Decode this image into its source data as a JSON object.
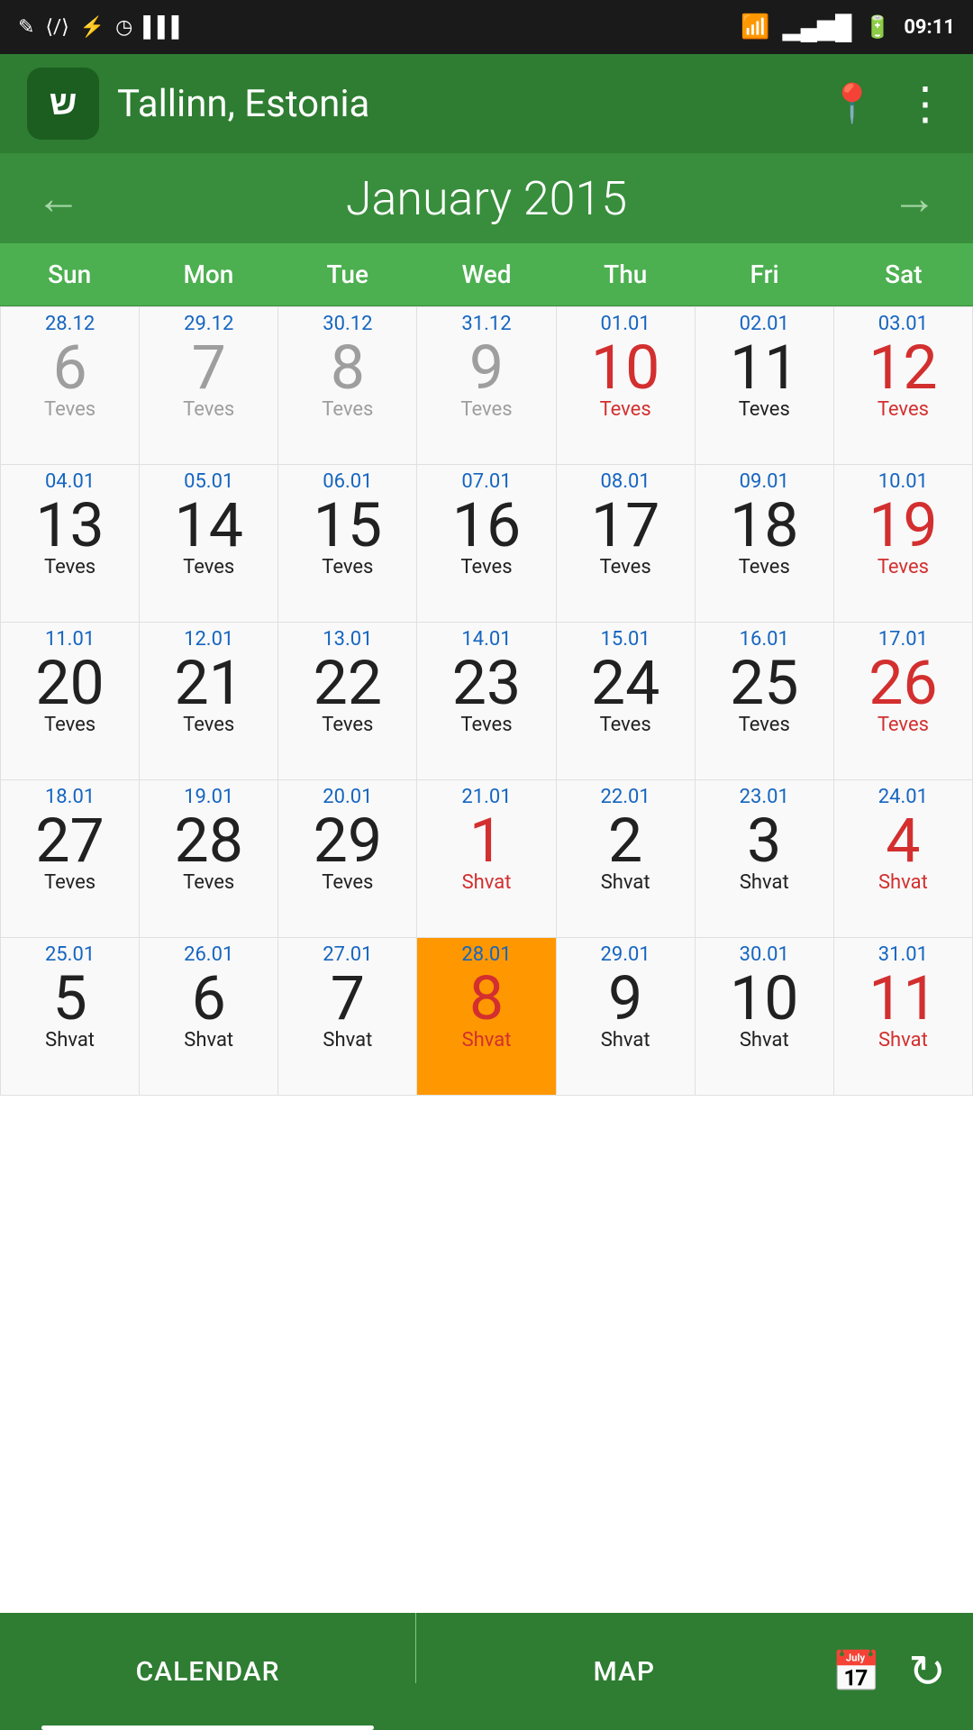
{
  "statusBar": {
    "time": "09:11",
    "leftIcons": [
      "✎",
      "⟨/⟩",
      "⚡",
      "◷",
      "▐▌▌"
    ],
    "rightIcons": [
      "wifi",
      "signal",
      "battery"
    ]
  },
  "header": {
    "logoText": "ש",
    "title": "Tallinn, Estonia",
    "locationIcon": "📍",
    "moreIcon": "⋮"
  },
  "monthNav": {
    "prevArrow": "←",
    "nextArrow": "→",
    "monthTitle": "January 2015"
  },
  "dayHeaders": [
    "Sun",
    "Mon",
    "Tue",
    "Wed",
    "Thu",
    "Fri",
    "Sat"
  ],
  "calendarCells": [
    {
      "greg": "28.12",
      "day": "6",
      "heb": "Teves",
      "dayColor": "gray",
      "hebColor": "gray",
      "gregColor": "normal"
    },
    {
      "greg": "29.12",
      "day": "7",
      "heb": "Teves",
      "dayColor": "gray",
      "hebColor": "gray",
      "gregColor": "normal"
    },
    {
      "greg": "30.12",
      "day": "8",
      "heb": "Teves",
      "dayColor": "gray",
      "hebColor": "gray",
      "gregColor": "normal"
    },
    {
      "greg": "31.12",
      "day": "9",
      "heb": "Teves",
      "dayColor": "gray",
      "hebColor": "gray",
      "gregColor": "normal"
    },
    {
      "greg": "01.01",
      "day": "10",
      "heb": "Teves",
      "dayColor": "red",
      "hebColor": "red",
      "gregColor": "normal"
    },
    {
      "greg": "02.01",
      "day": "11",
      "heb": "Teves",
      "dayColor": "black",
      "hebColor": "black",
      "gregColor": "normal"
    },
    {
      "greg": "03.01",
      "day": "12",
      "heb": "Teves",
      "dayColor": "red",
      "hebColor": "red",
      "gregColor": "normal"
    },
    {
      "greg": "04.01",
      "day": "13",
      "heb": "Teves",
      "dayColor": "black",
      "hebColor": "black",
      "gregColor": "normal"
    },
    {
      "greg": "05.01",
      "day": "14",
      "heb": "Teves",
      "dayColor": "black",
      "hebColor": "black",
      "gregColor": "normal"
    },
    {
      "greg": "06.01",
      "day": "15",
      "heb": "Teves",
      "dayColor": "black",
      "hebColor": "black",
      "gregColor": "normal"
    },
    {
      "greg": "07.01",
      "day": "16",
      "heb": "Teves",
      "dayColor": "black",
      "hebColor": "black",
      "gregColor": "normal"
    },
    {
      "greg": "08.01",
      "day": "17",
      "heb": "Teves",
      "dayColor": "black",
      "hebColor": "black",
      "gregColor": "normal"
    },
    {
      "greg": "09.01",
      "day": "18",
      "heb": "Teves",
      "dayColor": "black",
      "hebColor": "black",
      "gregColor": "normal"
    },
    {
      "greg": "10.01",
      "day": "19",
      "heb": "Teves",
      "dayColor": "red",
      "hebColor": "red",
      "gregColor": "normal"
    },
    {
      "greg": "11.01",
      "day": "20",
      "heb": "Teves",
      "dayColor": "black",
      "hebColor": "black",
      "gregColor": "normal"
    },
    {
      "greg": "12.01",
      "day": "21",
      "heb": "Teves",
      "dayColor": "black",
      "hebColor": "black",
      "gregColor": "normal"
    },
    {
      "greg": "13.01",
      "day": "22",
      "heb": "Teves",
      "dayColor": "black",
      "hebColor": "black",
      "gregColor": "normal"
    },
    {
      "greg": "14.01",
      "day": "23",
      "heb": "Teves",
      "dayColor": "black",
      "hebColor": "black",
      "gregColor": "normal"
    },
    {
      "greg": "15.01",
      "day": "24",
      "heb": "Teves",
      "dayColor": "black",
      "hebColor": "black",
      "gregColor": "normal"
    },
    {
      "greg": "16.01",
      "day": "25",
      "heb": "Teves",
      "dayColor": "black",
      "hebColor": "black",
      "gregColor": "normal"
    },
    {
      "greg": "17.01",
      "day": "26",
      "heb": "Teves",
      "dayColor": "red",
      "hebColor": "red",
      "gregColor": "normal"
    },
    {
      "greg": "18.01",
      "day": "27",
      "heb": "Teves",
      "dayColor": "black",
      "hebColor": "black",
      "gregColor": "normal"
    },
    {
      "greg": "19.01",
      "day": "28",
      "heb": "Teves",
      "dayColor": "black",
      "hebColor": "black",
      "gregColor": "normal"
    },
    {
      "greg": "20.01",
      "day": "29",
      "heb": "Teves",
      "dayColor": "black",
      "hebColor": "black",
      "gregColor": "normal"
    },
    {
      "greg": "21.01",
      "day": "1",
      "heb": "Shvat",
      "dayColor": "red",
      "hebColor": "red",
      "gregColor": "normal"
    },
    {
      "greg": "22.01",
      "day": "2",
      "heb": "Shvat",
      "dayColor": "black",
      "hebColor": "black",
      "gregColor": "normal"
    },
    {
      "greg": "23.01",
      "day": "3",
      "heb": "Shvat",
      "dayColor": "black",
      "hebColor": "black",
      "gregColor": "normal"
    },
    {
      "greg": "24.01",
      "day": "4",
      "heb": "Shvat",
      "dayColor": "red",
      "hebColor": "red",
      "gregColor": "normal"
    },
    {
      "greg": "25.01",
      "day": "5",
      "heb": "Shvat",
      "dayColor": "black",
      "hebColor": "black",
      "gregColor": "normal"
    },
    {
      "greg": "26.01",
      "day": "6",
      "heb": "Shvat",
      "dayColor": "black",
      "hebColor": "black",
      "gregColor": "normal"
    },
    {
      "greg": "27.01",
      "day": "7",
      "heb": "Shvat",
      "dayColor": "black",
      "hebColor": "black",
      "gregColor": "normal"
    },
    {
      "greg": "28.01",
      "day": "8",
      "heb": "Shvat",
      "dayColor": "red",
      "hebColor": "red",
      "gregColor": "today",
      "isToday": true
    },
    {
      "greg": "29.01",
      "day": "9",
      "heb": "Shvat",
      "dayColor": "black",
      "hebColor": "black",
      "gregColor": "normal"
    },
    {
      "greg": "30.01",
      "day": "10",
      "heb": "Shvat",
      "dayColor": "black",
      "hebColor": "black",
      "gregColor": "normal"
    },
    {
      "greg": "31.01",
      "day": "11",
      "heb": "Shvat",
      "dayColor": "red",
      "hebColor": "red",
      "gregColor": "normal"
    }
  ],
  "bottomNav": {
    "calendarLabel": "CALENDAR",
    "mapLabel": "MAP",
    "calendarIcon": "📅",
    "refreshIcon": "↻"
  }
}
